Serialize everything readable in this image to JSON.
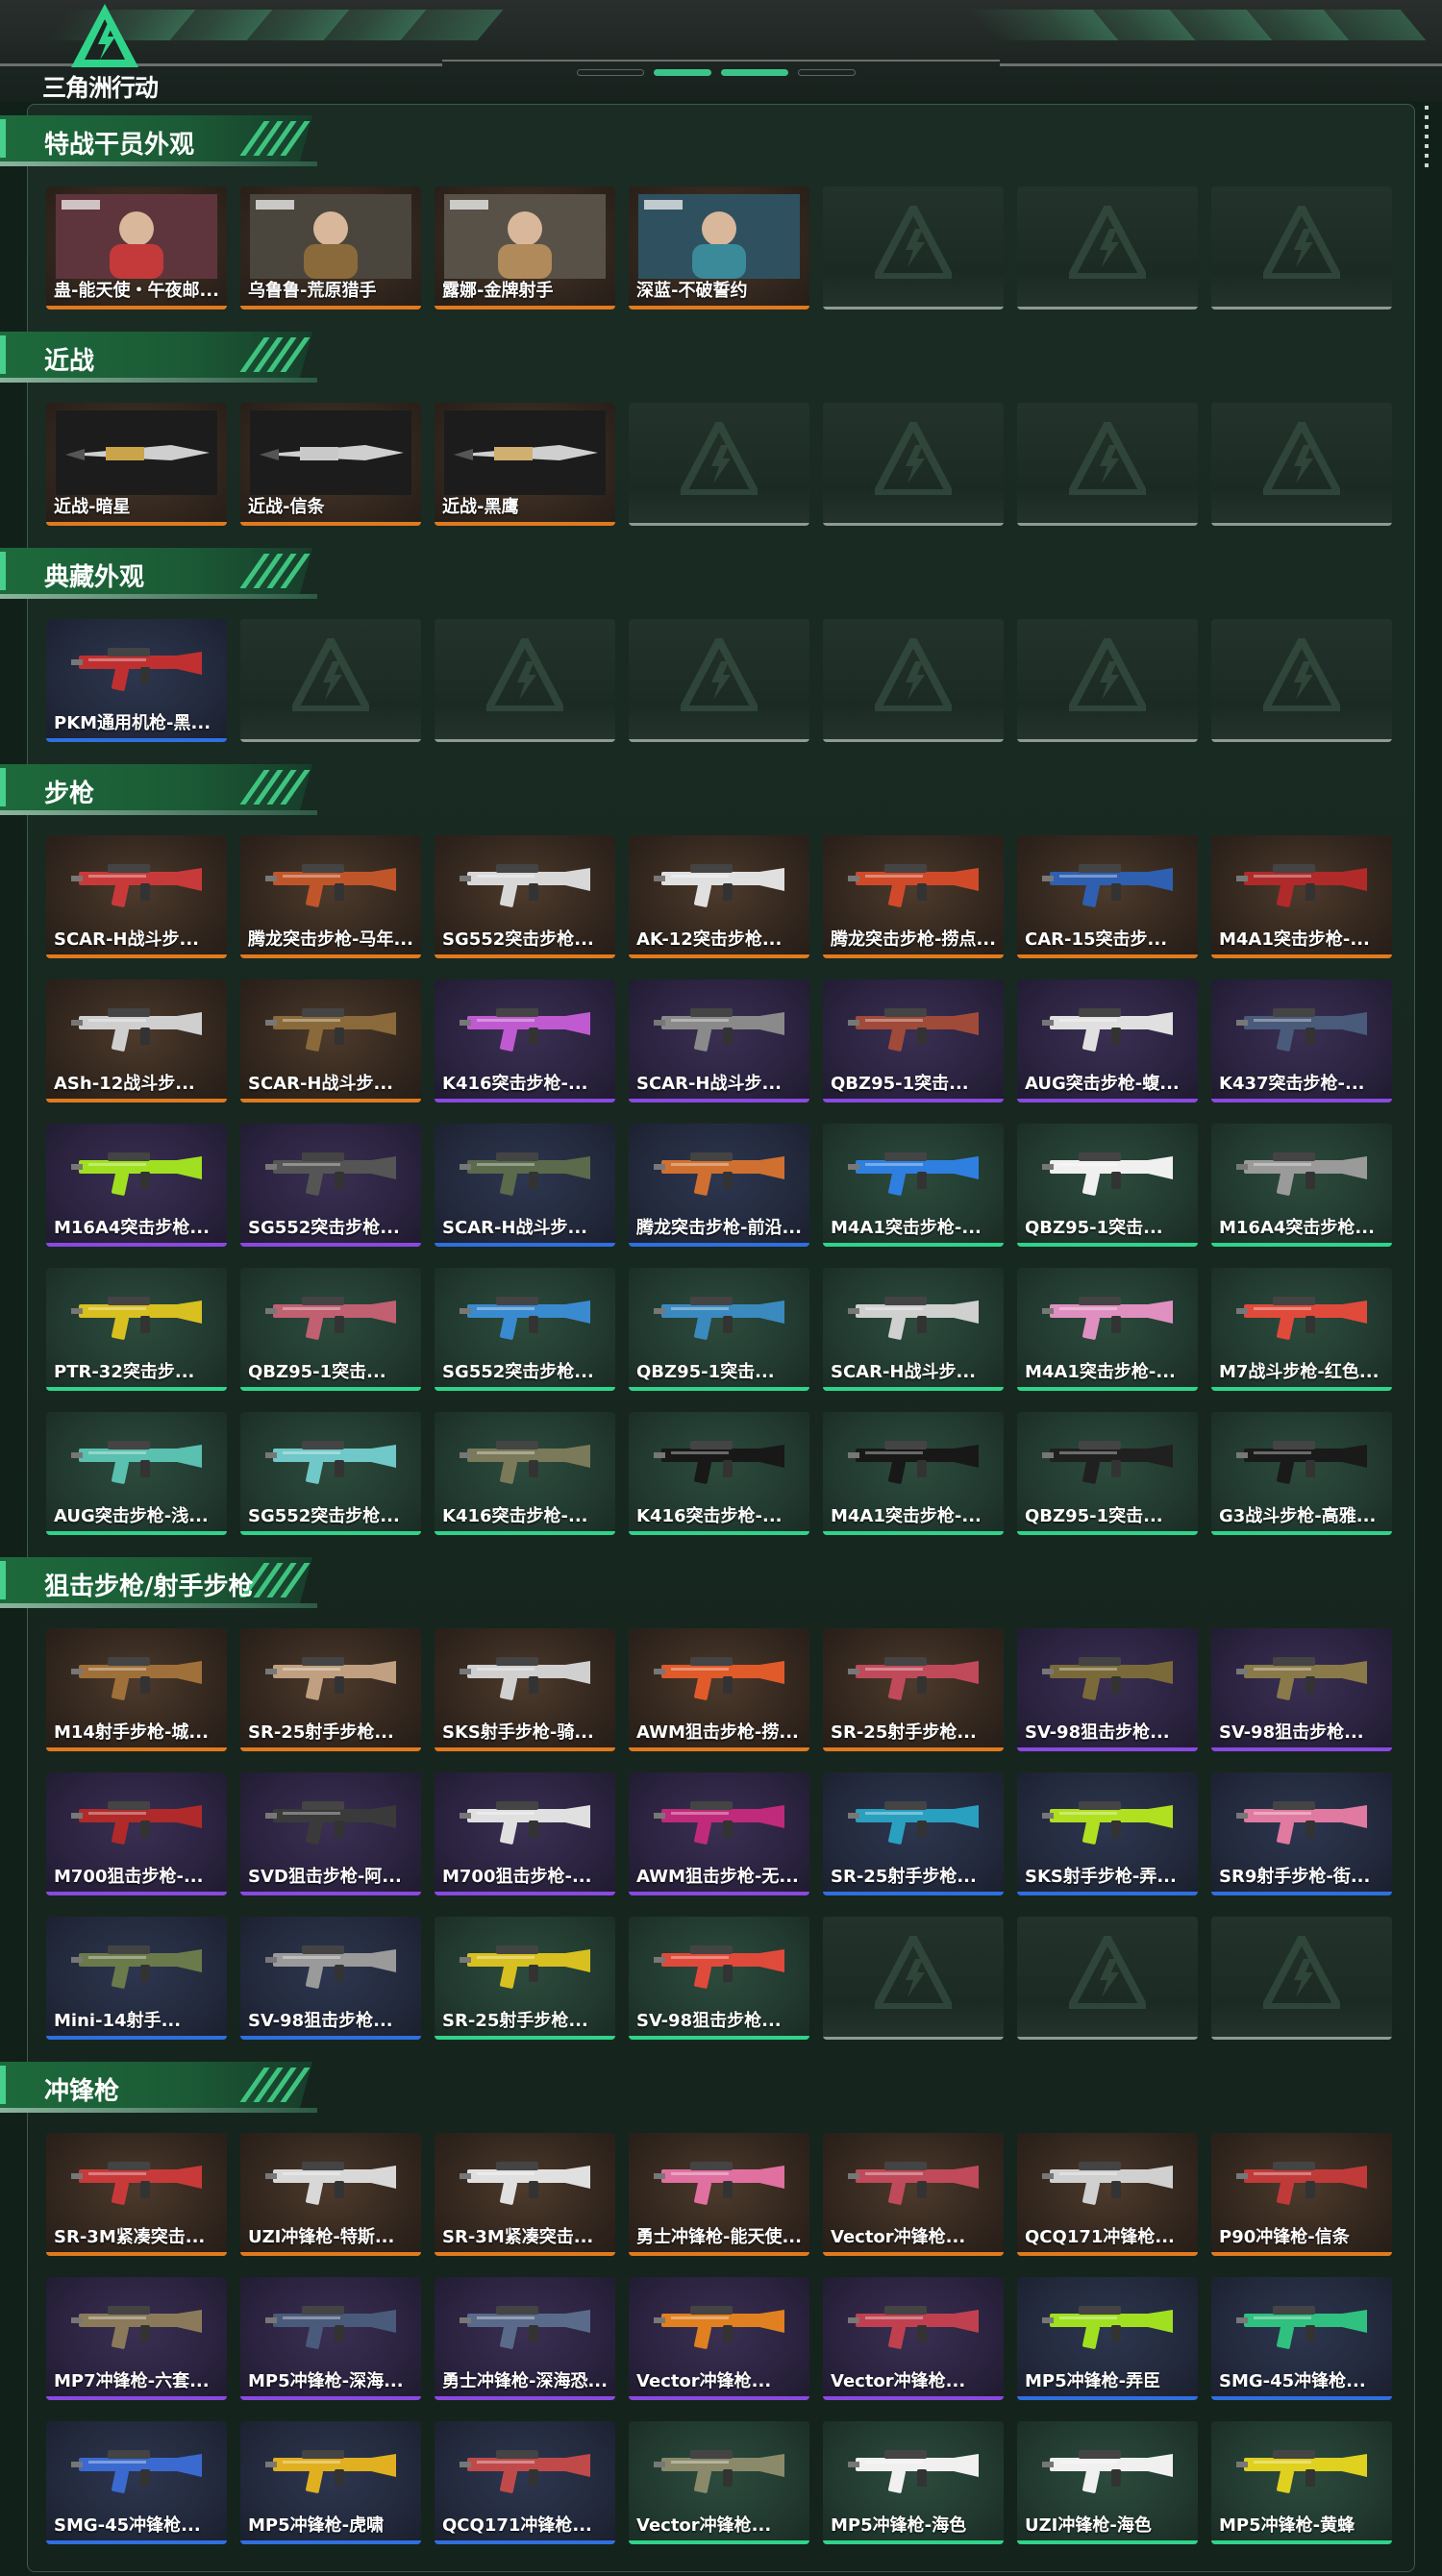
{
  "app": {
    "logo_text": "三角洲行动"
  },
  "sections": [
    {
      "title": "特战干员外观",
      "cards": [
        {
          "name": "蛊-能天使・午夜邮...",
          "rarity": "orange",
          "icon": "operator-portrait-icon",
          "color": "#c43a3a"
        },
        {
          "name": "乌鲁鲁-荒原猎手",
          "rarity": "orange",
          "icon": "operator-portrait-icon",
          "color": "#8a6a3a"
        },
        {
          "name": "露娜-金牌射手",
          "rarity": "orange",
          "icon": "operator-portrait-icon",
          "color": "#b08a5a"
        },
        {
          "name": "深蓝-不破誓约",
          "rarity": "orange",
          "icon": "operator-portrait-icon",
          "color": "#3a8a9a"
        },
        {
          "empty": true
        },
        {
          "empty": true
        },
        {
          "empty": true
        }
      ]
    },
    {
      "title": "近战",
      "cards": [
        {
          "name": "近战-暗星",
          "rarity": "orange",
          "icon": "melee-knife-icon",
          "color": "#c9a44a"
        },
        {
          "name": "近战-信条",
          "rarity": "orange",
          "icon": "melee-knife-icon",
          "color": "#c9c9c9"
        },
        {
          "name": "近战-黑鹰",
          "rarity": "orange",
          "icon": "melee-knife-icon",
          "color": "#d0b070"
        },
        {
          "empty": true
        },
        {
          "empty": true
        },
        {
          "empty": true
        },
        {
          "empty": true
        }
      ]
    },
    {
      "title": "典藏外观",
      "cards": [
        {
          "name": "PKM通用机枪-黑...",
          "rarity": "blue",
          "icon": "machine-gun-icon",
          "color": "#c03030"
        },
        {
          "empty": true
        },
        {
          "empty": true
        },
        {
          "empty": true
        },
        {
          "empty": true
        },
        {
          "empty": true
        },
        {
          "empty": true
        }
      ]
    },
    {
      "title": "步枪",
      "cards": [
        {
          "name": "SCAR-H战斗步...",
          "rarity": "orange",
          "icon": "rifle-icon",
          "color": "#c83a3a"
        },
        {
          "name": "腾龙突击步枪-马年...",
          "rarity": "orange",
          "icon": "rifle-icon",
          "color": "#c0552a"
        },
        {
          "name": "SG552突击步枪...",
          "rarity": "orange",
          "icon": "rifle-icon",
          "color": "#d8d8d8"
        },
        {
          "name": "AK-12突击步枪...",
          "rarity": "orange",
          "icon": "rifle-icon",
          "color": "#e0e0e0"
        },
        {
          "name": "腾龙突击步枪-捞点...",
          "rarity": "orange",
          "icon": "rifle-icon",
          "color": "#d04a2a"
        },
        {
          "name": "CAR-15突击步...",
          "rarity": "orange",
          "icon": "rifle-icon",
          "color": "#2f5fb0"
        },
        {
          "name": "M4A1突击步枪-...",
          "rarity": "orange",
          "icon": "rifle-icon",
          "color": "#b02a2a"
        },
        {
          "name": "ASh-12战斗步...",
          "rarity": "orange",
          "icon": "rifle-icon",
          "color": "#cfcfcf"
        },
        {
          "name": "SCAR-H战斗步...",
          "rarity": "orange",
          "icon": "rifle-icon",
          "color": "#8a6a3a"
        },
        {
          "name": "K416突击步枪-...",
          "rarity": "purple",
          "icon": "rifle-icon",
          "color": "#c05ad0"
        },
        {
          "name": "SCAR-H战斗步...",
          "rarity": "purple",
          "icon": "rifle-icon",
          "color": "#8a8a8a"
        },
        {
          "name": "QBZ95-1突击...",
          "rarity": "purple",
          "icon": "rifle-icon",
          "color": "#a04a3a"
        },
        {
          "name": "AUG突击步枪-蝮...",
          "rarity": "purple",
          "icon": "rifle-icon",
          "color": "#e0e0e0"
        },
        {
          "name": "K437突击步枪-...",
          "rarity": "purple",
          "icon": "rifle-icon",
          "color": "#4a5a7a"
        },
        {
          "name": "M16A4突击步枪...",
          "rarity": "purple",
          "icon": "rifle-icon",
          "color": "#a0e020"
        },
        {
          "name": "SG552突击步枪...",
          "rarity": "purple",
          "icon": "rifle-icon",
          "color": "#555555"
        },
        {
          "name": "SCAR-H战斗步...",
          "rarity": "blue",
          "icon": "rifle-icon",
          "color": "#5a6a4a"
        },
        {
          "name": "腾龙突击步枪-前沿...",
          "rarity": "blue",
          "icon": "rifle-icon",
          "color": "#d07030"
        },
        {
          "name": "M4A1突击步枪-...",
          "rarity": "green",
          "icon": "rifle-icon",
          "color": "#2f7fe0"
        },
        {
          "name": "QBZ95-1突击...",
          "rarity": "green",
          "icon": "rifle-icon",
          "color": "#f0f0f0"
        },
        {
          "name": "M16A4突击步枪...",
          "rarity": "green",
          "icon": "rifle-icon",
          "color": "#9a9a9a"
        },
        {
          "name": "PTR-32突击步...",
          "rarity": "green",
          "icon": "rifle-icon",
          "color": "#d8c020"
        },
        {
          "name": "QBZ95-1突击...",
          "rarity": "green",
          "icon": "rifle-icon",
          "color": "#c06070"
        },
        {
          "name": "SG552突击步枪...",
          "rarity": "green",
          "icon": "rifle-icon",
          "color": "#3a8ad0"
        },
        {
          "name": "QBZ95-1突击...",
          "rarity": "green",
          "icon": "rifle-icon",
          "color": "#3a8ac0"
        },
        {
          "name": "SCAR-H战斗步...",
          "rarity": "green",
          "icon": "rifle-icon",
          "color": "#d0d0d0"
        },
        {
          "name": "M4A1突击步枪-...",
          "rarity": "green",
          "icon": "rifle-icon",
          "color": "#e090c0"
        },
        {
          "name": "M7战斗步枪-红色...",
          "rarity": "green",
          "icon": "rifle-icon",
          "color": "#e04a3a"
        },
        {
          "name": "AUG突击步枪-浅...",
          "rarity": "green",
          "icon": "rifle-icon",
          "color": "#5ac0b0"
        },
        {
          "name": "SG552突击步枪...",
          "rarity": "green",
          "icon": "rifle-icon",
          "color": "#70c8c8"
        },
        {
          "name": "K416突击步枪-...",
          "rarity": "green",
          "icon": "rifle-icon",
          "color": "#7a7a5a"
        },
        {
          "name": "K416突击步枪-...",
          "rarity": "green",
          "icon": "rifle-icon",
          "color": "#181818"
        },
        {
          "name": "M4A1突击步枪-...",
          "rarity": "green",
          "icon": "rifle-icon",
          "color": "#181818"
        },
        {
          "name": "QBZ95-1突击...",
          "rarity": "green",
          "icon": "rifle-icon",
          "color": "#202020"
        },
        {
          "name": "G3战斗步枪-高雅...",
          "rarity": "green",
          "icon": "rifle-icon",
          "color": "#1a1a1a"
        }
      ]
    },
    {
      "title": "狙击步枪/射手步枪",
      "cards": [
        {
          "name": "M14射手步枪-城...",
          "rarity": "orange",
          "icon": "sniper-rifle-icon",
          "color": "#a0703a"
        },
        {
          "name": "SR-25射手步枪...",
          "rarity": "orange",
          "icon": "sniper-rifle-icon",
          "color": "#c0a080"
        },
        {
          "name": "SKS射手步枪-骑...",
          "rarity": "orange",
          "icon": "sniper-rifle-icon",
          "color": "#d0d0d0"
        },
        {
          "name": "AWM狙击步枪-捞...",
          "rarity": "orange",
          "icon": "sniper-rifle-icon",
          "color": "#e05a2a"
        },
        {
          "name": "SR-25射手步枪...",
          "rarity": "orange",
          "icon": "sniper-rifle-icon",
          "color": "#c04a5a"
        },
        {
          "name": "SV-98狙击步枪...",
          "rarity": "purple",
          "icon": "sniper-rifle-icon",
          "color": "#7a6a3a"
        },
        {
          "name": "SV-98狙击步枪...",
          "rarity": "purple",
          "icon": "sniper-rifle-icon",
          "color": "#8a7a4a"
        },
        {
          "name": "M700狙击步枪-...",
          "rarity": "purple",
          "icon": "sniper-rifle-icon",
          "color": "#b02a2a"
        },
        {
          "name": "SVD狙击步枪-阿...",
          "rarity": "purple",
          "icon": "sniper-rifle-icon",
          "color": "#3a3a3a"
        },
        {
          "name": "M700狙击步枪-...",
          "rarity": "purple",
          "icon": "sniper-rifle-icon",
          "color": "#e0e0e0"
        },
        {
          "name": "AWM狙击步枪-无...",
          "rarity": "purple",
          "icon": "sniper-rifle-icon",
          "color": "#c02a7a"
        },
        {
          "name": "SR-25射手步枪...",
          "rarity": "blue",
          "icon": "sniper-rifle-icon",
          "color": "#2aa0c0"
        },
        {
          "name": "SKS射手步枪-弄...",
          "rarity": "blue",
          "icon": "sniper-rifle-icon",
          "color": "#b0e020"
        },
        {
          "name": "SR9射手步枪-街...",
          "rarity": "blue",
          "icon": "sniper-rifle-icon",
          "color": "#e07aa0"
        },
        {
          "name": "Mini-14射手...",
          "rarity": "blue",
          "icon": "sniper-rifle-icon",
          "color": "#6a7a4a"
        },
        {
          "name": "SV-98狙击步枪...",
          "rarity": "blue",
          "icon": "sniper-rifle-icon",
          "color": "#9a9a9a"
        },
        {
          "name": "SR-25射手步枪...",
          "rarity": "green",
          "icon": "sniper-rifle-icon",
          "color": "#d8c020"
        },
        {
          "name": "SV-98狙击步枪...",
          "rarity": "green",
          "icon": "sniper-rifle-icon",
          "color": "#e04a3a"
        },
        {
          "empty": true
        },
        {
          "empty": true
        },
        {
          "empty": true
        }
      ]
    },
    {
      "title": "冲锋枪",
      "cards": [
        {
          "name": "SR-3M紧凑突击...",
          "rarity": "orange",
          "icon": "smg-icon",
          "color": "#c83a3a"
        },
        {
          "name": "UZI冲锋枪-特斯...",
          "rarity": "orange",
          "icon": "smg-icon",
          "color": "#d8d8d8"
        },
        {
          "name": "SR-3M紧凑突击...",
          "rarity": "orange",
          "icon": "smg-icon",
          "color": "#e0e0e0"
        },
        {
          "name": "勇士冲锋枪-能天使...",
          "rarity": "orange",
          "icon": "smg-icon",
          "color": "#e070a0"
        },
        {
          "name": "Vector冲锋枪...",
          "rarity": "orange",
          "icon": "smg-icon",
          "color": "#c04a5a"
        },
        {
          "name": "QCQ171冲锋枪...",
          "rarity": "orange",
          "icon": "smg-icon",
          "color": "#d0d0d0"
        },
        {
          "name": "P90冲锋枪-信条",
          "rarity": "orange",
          "icon": "smg-icon",
          "color": "#c03a3a"
        },
        {
          "name": "MP7冲锋枪-六套...",
          "rarity": "purple",
          "icon": "smg-icon",
          "color": "#8a7a5a"
        },
        {
          "name": "MP5冲锋枪-深海...",
          "rarity": "purple",
          "icon": "smg-icon",
          "color": "#4a5a7a"
        },
        {
          "name": "勇士冲锋枪-深海恐...",
          "rarity": "purple",
          "icon": "smg-icon",
          "color": "#5a6a8a"
        },
        {
          "name": "Vector冲锋枪...",
          "rarity": "purple",
          "icon": "smg-icon",
          "color": "#e08020"
        },
        {
          "name": "Vector冲锋枪...",
          "rarity": "purple",
          "icon": "smg-icon",
          "color": "#c04050"
        },
        {
          "name": "MP5冲锋枪-弄臣",
          "rarity": "blue",
          "icon": "smg-icon",
          "color": "#a0e020"
        },
        {
          "name": "SMG-45冲锋枪...",
          "rarity": "blue",
          "icon": "smg-icon",
          "color": "#30c080"
        },
        {
          "name": "SMG-45冲锋枪...",
          "rarity": "blue",
          "icon": "smg-icon",
          "color": "#3a6ad0"
        },
        {
          "name": "MP5冲锋枪-虎啸",
          "rarity": "blue",
          "icon": "smg-icon",
          "color": "#e0b020"
        },
        {
          "name": "QCQ171冲锋枪...",
          "rarity": "blue",
          "icon": "smg-icon",
          "color": "#c04a4a"
        },
        {
          "name": "Vector冲锋枪...",
          "rarity": "green",
          "icon": "smg-icon",
          "color": "#8a8a6a"
        },
        {
          "name": "MP5冲锋枪-海色",
          "rarity": "green",
          "icon": "smg-icon",
          "color": "#f0f0f0"
        },
        {
          "name": "UZI冲锋枪-海色",
          "rarity": "green",
          "icon": "smg-icon",
          "color": "#f0f0f0"
        },
        {
          "name": "MP5冲锋枪-黄蜂",
          "rarity": "green",
          "icon": "smg-icon",
          "color": "#e0d020"
        }
      ]
    }
  ]
}
